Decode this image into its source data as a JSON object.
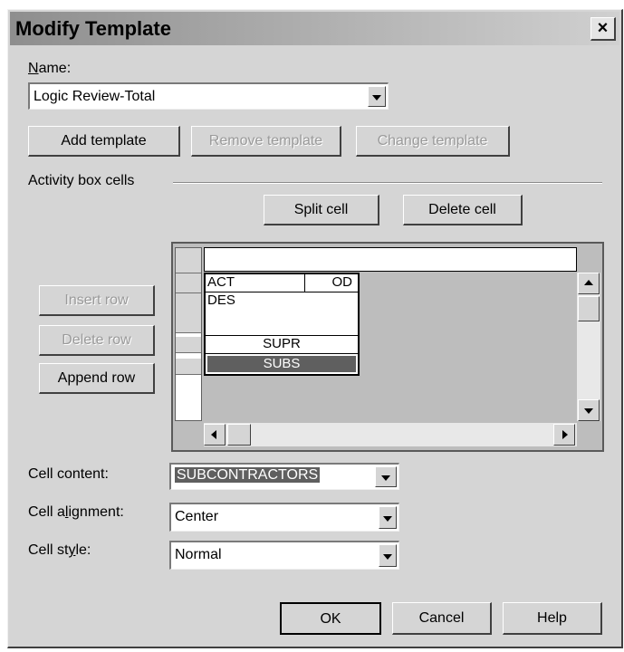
{
  "window": {
    "title": "Modify Template",
    "close_glyph": "×"
  },
  "name": {
    "label_u": "N",
    "label_rest": "ame:",
    "value": "Logic Review-Total"
  },
  "template_buttons": {
    "add": "Add template",
    "remove": "Remove template",
    "change": "Change template"
  },
  "activity": {
    "section_label": "Activity box cells",
    "split": "Split cell",
    "delete": "Delete cell"
  },
  "row_buttons": {
    "insert": "Insert row",
    "delete": "Delete row",
    "append": "Append row"
  },
  "cells": {
    "act": "ACT",
    "od": "OD",
    "des": "DES",
    "supr": "SUPR",
    "subs": "SUBS"
  },
  "props": {
    "content_label": "Cell content:",
    "content_value": "SUBCONTRACTORS",
    "alignment_label_pre": "Cell a",
    "alignment_label_u": "l",
    "alignment_label_post": "ignment:",
    "alignment_value": "Center",
    "style_label_pre": "Cell st",
    "style_label_u": "y",
    "style_label_post": "le:",
    "style_value": "Normal"
  },
  "footer": {
    "ok": "OK",
    "cancel": "Cancel",
    "help": "Help"
  },
  "colors": {
    "dialog_bg": "#d5d5d5",
    "selection": "#5f5f5f"
  }
}
